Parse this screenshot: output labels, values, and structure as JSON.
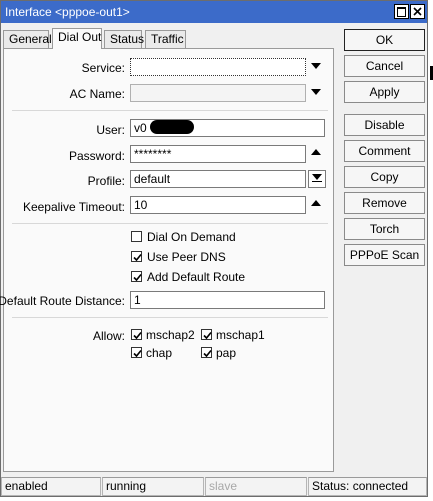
{
  "window": {
    "title": "Interface <pppoe-out1>"
  },
  "tabs": [
    {
      "label": "General"
    },
    {
      "label": "Dial Out"
    },
    {
      "label": "Status"
    },
    {
      "label": "Traffic"
    }
  ],
  "form": {
    "service": {
      "label": "Service:",
      "value": ""
    },
    "ac_name": {
      "label": "AC Name:",
      "value": ""
    },
    "user": {
      "label": "User:",
      "value": "v0"
    },
    "password": {
      "label": "Password:",
      "value": "********"
    },
    "profile": {
      "label": "Profile:",
      "value": "default"
    },
    "keepalive": {
      "label": "Keepalive Timeout:",
      "value": "10"
    },
    "dial_on_demand": {
      "label": "Dial On Demand",
      "checked": false
    },
    "use_peer_dns": {
      "label": "Use Peer DNS",
      "checked": true
    },
    "add_default_route": {
      "label": "Add Default Route",
      "checked": true
    },
    "default_route_distance": {
      "label": "Default Route Distance:",
      "value": "1"
    },
    "allow": {
      "label": "Allow:",
      "options": [
        {
          "label": "mschap2",
          "checked": true
        },
        {
          "label": "mschap1",
          "checked": true
        },
        {
          "label": "chap",
          "checked": true
        },
        {
          "label": "pap",
          "checked": true
        }
      ]
    }
  },
  "buttons": {
    "ok": "OK",
    "cancel": "Cancel",
    "apply": "Apply",
    "disable": "Disable",
    "comment": "Comment",
    "copy": "Copy",
    "remove": "Remove",
    "torch": "Torch",
    "pppoe_scan": "PPPoE Scan"
  },
  "status_bar": {
    "enabled": "enabled",
    "running": "running",
    "slave": "slave",
    "status": "Status: connected"
  },
  "colors": {
    "title_bar": "#3c6bc9",
    "panel": "#fafafa",
    "window": "#f0f0f0"
  }
}
